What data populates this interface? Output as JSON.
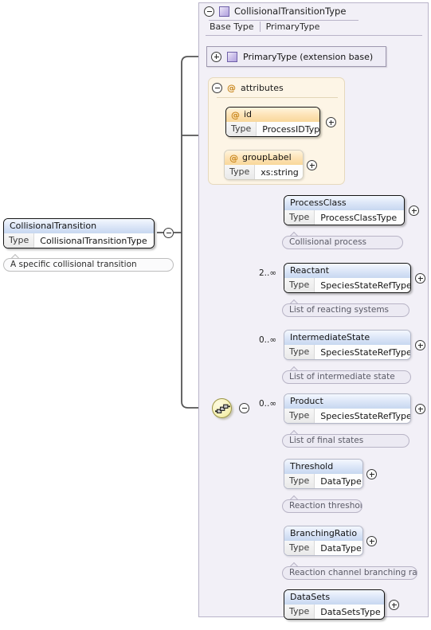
{
  "diagram": {
    "kind": "xsd-element-tree",
    "root_element": {
      "name": "CollisionalTransition",
      "type_key": "Type",
      "type_value": "CollisionalTransitionType",
      "documentation": "A specific collisional transition",
      "toggle": "minus"
    },
    "complex_type": {
      "name": "CollisionalTransitionType",
      "base_type_label": "Base Type",
      "base_type_value": "PrimaryType",
      "toggle": "minus",
      "glyph": "complextype-icon"
    },
    "extension_base": {
      "label": "PrimaryType (extension base)",
      "toggle": "plus",
      "glyph": "complextype-icon"
    },
    "attributes_group": {
      "label": "attributes",
      "toggle": "minus",
      "glyph": "attribute-icon",
      "items": [
        {
          "name": "id",
          "type_key": "Type",
          "type_value": "ProcessIDType",
          "use": "required",
          "toggle": "plus"
        },
        {
          "name": "groupLabel",
          "type_key": "Type",
          "type_value": "xs:string",
          "use": "optional",
          "toggle": "plus"
        }
      ]
    },
    "compositor": {
      "kind": "sequence",
      "toggle": "minus"
    },
    "children": [
      {
        "name": "ProcessClass",
        "type_key": "Type",
        "type_value": "ProcessClassType",
        "cardinality": "",
        "use": "required",
        "toggle": "plus",
        "documentation": "Collisional process"
      },
      {
        "name": "Reactant",
        "type_key": "Type",
        "type_value": "SpeciesStateRefType",
        "cardinality": "2..∞",
        "use": "required",
        "toggle": "plus",
        "documentation": "List of reacting systems"
      },
      {
        "name": "IntermediateState",
        "type_key": "Type",
        "type_value": "SpeciesStateRefType",
        "cardinality": "0..∞",
        "use": "optional",
        "toggle": "plus",
        "documentation": "List of intermediate state"
      },
      {
        "name": "Product",
        "type_key": "Type",
        "type_value": "SpeciesStateRefType",
        "cardinality": "0..∞",
        "use": "optional",
        "toggle": "plus",
        "documentation": "List of final states"
      },
      {
        "name": "Threshold",
        "type_key": "Type",
        "type_value": "DataType",
        "cardinality": "",
        "use": "optional",
        "toggle": "plus",
        "documentation": "Reaction threshold"
      },
      {
        "name": "BranchingRatio",
        "type_key": "Type",
        "type_value": "DataType",
        "cardinality": "",
        "use": "optional",
        "toggle": "plus",
        "documentation": "Reaction channel branching ratio"
      },
      {
        "name": "DataSets",
        "type_key": "Type",
        "type_value": "DataSetsType",
        "cardinality": "",
        "use": "required",
        "toggle": "plus",
        "documentation": ""
      }
    ]
  },
  "colors": {
    "container_bg": "#f2f0f7",
    "container_border": "#b9b4c9",
    "element_header_from": "#f4f8fe",
    "element_header_to": "#c7d7f0",
    "attribute_header_from": "#fff4de",
    "attribute_header_to": "#f8d79a",
    "attribute_panel_bg": "#fdf5e6",
    "sequence_fill": "#f7f2b8",
    "doc_bubble_bg": "#eceaf3",
    "wire": "#555555"
  }
}
